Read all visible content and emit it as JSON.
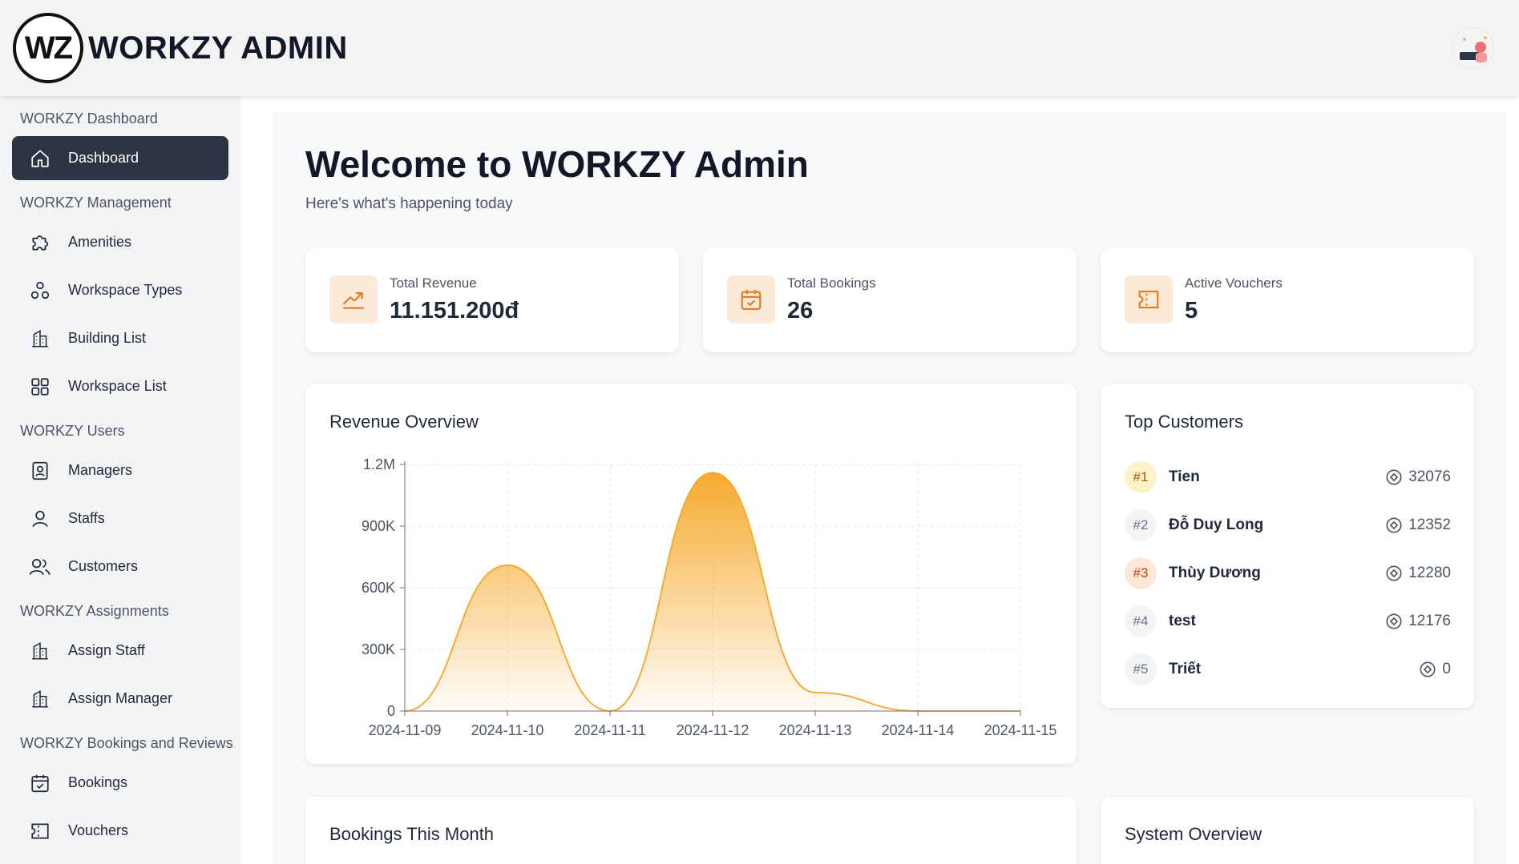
{
  "header": {
    "logo": "WZ",
    "brand": "WORKZY ADMIN"
  },
  "sidebar": {
    "sections": [
      {
        "title": "WORKZY Dashboard",
        "items": [
          {
            "label": "Dashboard",
            "icon": "home-icon",
            "active": true
          }
        ]
      },
      {
        "title": "WORKZY Management",
        "items": [
          {
            "label": "Amenities",
            "icon": "puzzle-icon"
          },
          {
            "label": "Workspace Types",
            "icon": "shapes-icon"
          },
          {
            "label": "Building List",
            "icon": "building-icon"
          },
          {
            "label": "Workspace List",
            "icon": "grid-icon"
          }
        ]
      },
      {
        "title": "WORKZY Users",
        "items": [
          {
            "label": "Managers",
            "icon": "badge-icon"
          },
          {
            "label": "Staffs",
            "icon": "user-icon"
          },
          {
            "label": "Customers",
            "icon": "users-icon"
          }
        ]
      },
      {
        "title": "WORKZY Assignments",
        "items": [
          {
            "label": "Assign Staff",
            "icon": "building-icon"
          },
          {
            "label": "Assign Manager",
            "icon": "building-icon"
          }
        ]
      },
      {
        "title": "WORKZY Bookings and Reviews",
        "items": [
          {
            "label": "Bookings",
            "icon": "calendar-check-icon"
          },
          {
            "label": "Vouchers",
            "icon": "ticket-icon"
          }
        ]
      }
    ]
  },
  "main": {
    "welcome": "Welcome to WORKZY Admin",
    "subtitle": "Here's what's happening today",
    "stats": [
      {
        "label": "Total Revenue",
        "value": "11.151.200đ",
        "icon": "trending-up-icon"
      },
      {
        "label": "Total Bookings",
        "value": "26",
        "icon": "calendar-check-icon"
      },
      {
        "label": "Active Vouchers",
        "value": "5",
        "icon": "ticket-icon"
      }
    ],
    "revenue_title": "Revenue Overview",
    "top_customers_title": "Top Customers",
    "customers": [
      {
        "rank": "#1",
        "name": "Tien",
        "points": "32076"
      },
      {
        "rank": "#2",
        "name": "Đỗ Duy Long",
        "points": "12352"
      },
      {
        "rank": "#3",
        "name": "Thùy Dương",
        "points": "12280"
      },
      {
        "rank": "#4",
        "name": "test",
        "points": "12176"
      },
      {
        "rank": "#5",
        "name": "Triết",
        "points": "0"
      }
    ],
    "bookings_month_title": "Bookings This Month",
    "system_overview_title": "System Overview"
  },
  "colors": {
    "accent": "#f5a623",
    "active_nav": "#2b3442",
    "icon_orange": "#e5791f"
  },
  "chart_data": {
    "type": "area",
    "x": [
      "2024-11-09",
      "2024-11-10",
      "2024-11-11",
      "2024-11-12",
      "2024-11-13",
      "2024-11-14",
      "2024-11-15"
    ],
    "values": [
      0,
      710000,
      0,
      1160000,
      90000,
      0,
      0
    ],
    "yticks": [
      "0",
      "300K",
      "600K",
      "900K",
      "1.2M"
    ],
    "ylim": [
      0,
      1200000
    ],
    "grid": true,
    "color": "#f5a623"
  }
}
